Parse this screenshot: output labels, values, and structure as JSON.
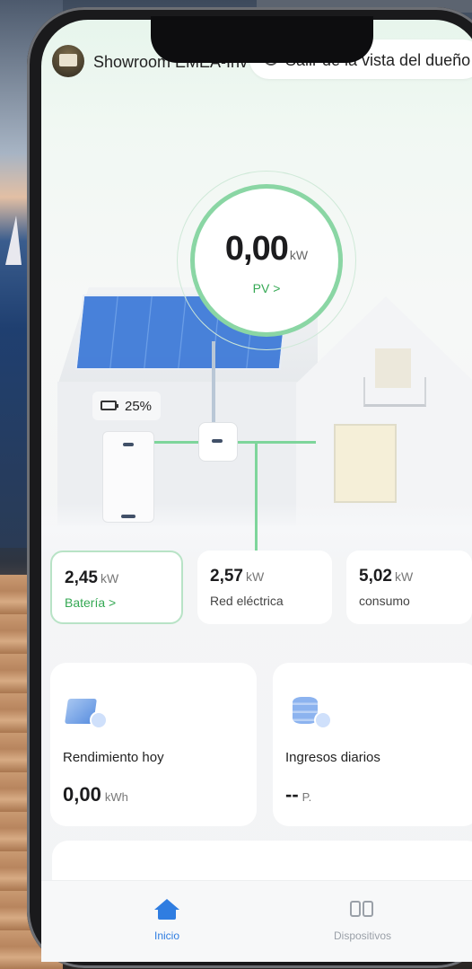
{
  "header": {
    "station_name": "Showroom EMEA-Inv",
    "owner_view_button": "Salir de la vista del dueño"
  },
  "pv": {
    "value": "0,00",
    "unit": "kW",
    "link": "PV >"
  },
  "battery": {
    "soc": "25%"
  },
  "metrics": [
    {
      "value": "2,45",
      "unit": "kW",
      "label": "Batería >"
    },
    {
      "value": "2,57",
      "unit": "kW",
      "label": "Red eléctrica"
    },
    {
      "value": "5,02",
      "unit": "kW",
      "label": "consumo"
    }
  ],
  "stats": [
    {
      "title": "Rendimiento hoy",
      "value": "0,00",
      "unit": "kWh",
      "icon": "solar-panel-icon"
    },
    {
      "title": "Ingresos diarios",
      "value": "--",
      "unit": "P.",
      "icon": "coins-icon"
    }
  ],
  "tabs": [
    {
      "label": "Inicio",
      "icon": "home-icon",
      "active": true
    },
    {
      "label": "Dispositivos",
      "icon": "devices-icon",
      "active": false
    }
  ],
  "colors": {
    "accent_green": "#34a853",
    "flow_line": "#7ed59b",
    "tab_active": "#2f7de1"
  }
}
